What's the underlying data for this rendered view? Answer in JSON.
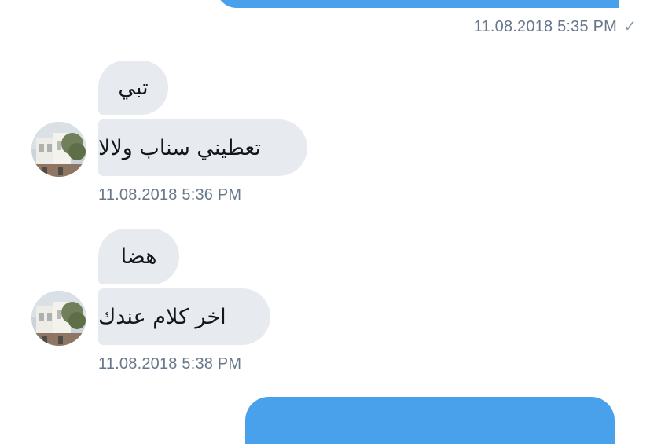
{
  "conversation": {
    "first_sent": {
      "timestamp": "11.08.2018 5:35 PM",
      "status_icon": "check-icon"
    },
    "group1": {
      "messages": [
        "تبي",
        "تعطيني سناب ولالا"
      ],
      "timestamp": "11.08.2018 5:36 PM"
    },
    "group2": {
      "messages": [
        "هضا",
        "اخر كلام عندك"
      ],
      "timestamp": "11.08.2018 5:38 PM"
    }
  },
  "colors": {
    "sent_bubble": "#4aa1eb",
    "received_bubble": "#e7ebef",
    "timestamp": "#68788a"
  }
}
